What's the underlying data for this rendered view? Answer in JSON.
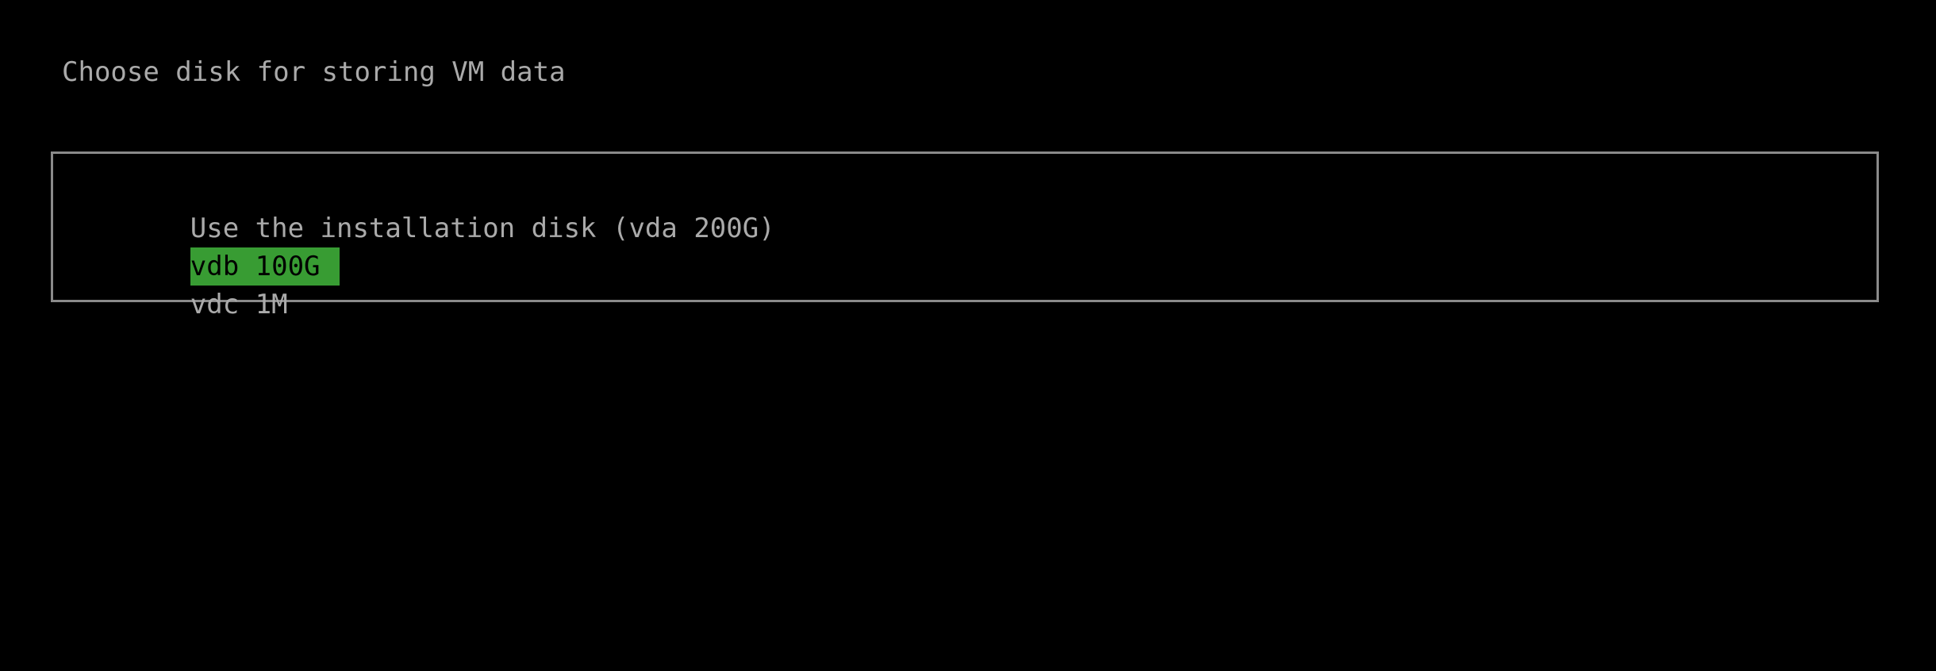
{
  "screen": {
    "background_color": "#000000",
    "foreground_color": "#aaaaaa",
    "mode": "text-console-installer"
  },
  "prompt": {
    "title": "Choose disk for storing VM data"
  },
  "disk_list": {
    "border_color": "#8a8a8a",
    "selection_background_color": "#389c33",
    "selection_foreground_color": "#000000",
    "selected_index": 1,
    "items": [
      {
        "label": "Use the installation disk (vda 200G)",
        "device": "vda",
        "size": "200G",
        "selected": false
      },
      {
        "label": "vdb 100G",
        "device": "vdb",
        "size": "100G",
        "selected": true
      },
      {
        "label": "vdc 1M",
        "device": "vdc",
        "size": "1M",
        "selected": false
      }
    ]
  }
}
